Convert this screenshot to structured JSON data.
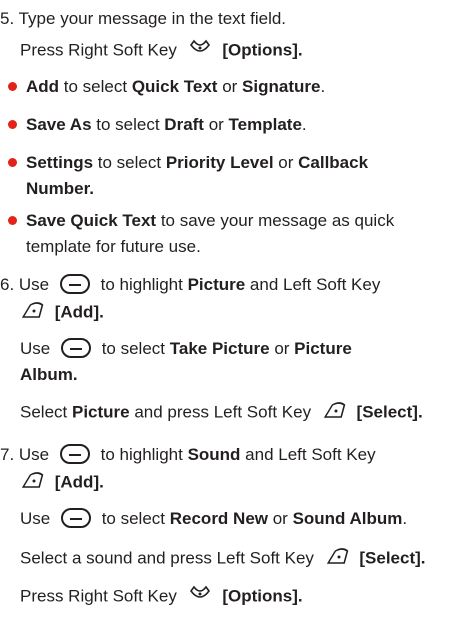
{
  "step5": {
    "num": "5.",
    "l1": "Type your message in the text field.",
    "l2_pre": "Press Right Soft Key",
    "l2_opt": "[Options]."
  },
  "bullets": [
    {
      "a": "Add",
      "t1": " to select ",
      "b": "Quick Text",
      "t2": " or ",
      "c": "Signature",
      "t3": "."
    },
    {
      "a": "Save As",
      "t1": " to select ",
      "b": "Draft",
      "t2": " or ",
      "c": "Template",
      "t3": "."
    },
    {
      "a": "Settings",
      "t1": " to select ",
      "b": "Priority Level",
      "t2": " or ",
      "c": "Callback"
    },
    {
      "a": "Save Quick Text",
      "t1": " to save your message as quick"
    }
  ],
  "bullet_cont": {
    "settings": "Number.",
    "sqt": "template for future use."
  },
  "step6": {
    "num": "6. Use",
    "t1": "to highlight ",
    "picture": "Picture",
    "t2": " and Left Soft Key",
    "add": "[Add].",
    "use": "Use",
    "t3": "to select ",
    "take": "Take Picture",
    "or": " or ",
    "pic": "Picture",
    "album": "Album.",
    "sel": "Select ",
    "sel_pic": "Picture",
    "sel_t": " and press Left Soft Key",
    "select": "[Select]."
  },
  "step7": {
    "num": "7. Use",
    "t1": "to highlight ",
    "sound": "Sound",
    "t2": " and Left Soft Key",
    "add": "[Add].",
    "use": "Use",
    "t3": "to select ",
    "rec": "Record New",
    "or": " or ",
    "album": "Sound Album",
    ".": ".",
    "sel": "Select a sound and press Left Soft Key",
    "select": "[Select].",
    "press": "Press Right Soft Key",
    "opt": "[Options]."
  },
  "icons": [
    "right-soft-key-icon",
    "left-soft-key-icon",
    "navigation-key-icon"
  ],
  "colors": {
    "text": "#231f20",
    "bullet": "#e2231a"
  }
}
